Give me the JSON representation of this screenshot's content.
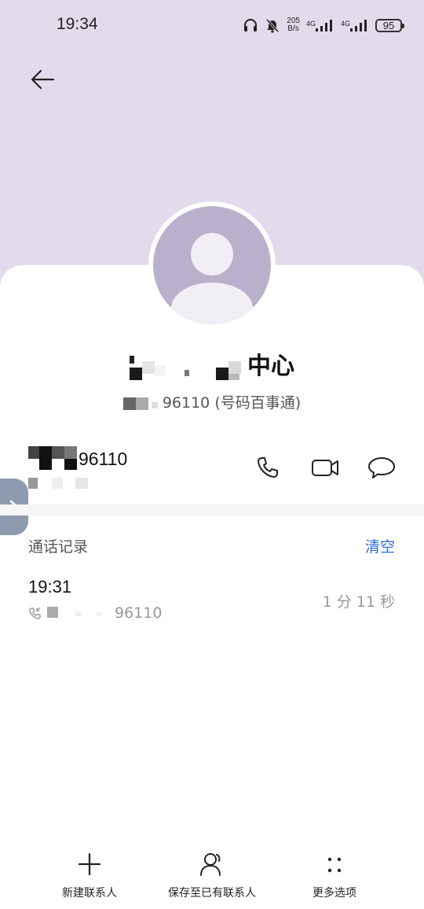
{
  "status_bar": {
    "time": "19:34",
    "net_speed_value": "205",
    "net_speed_unit": "B/s",
    "signal_1_label": "4G",
    "signal_2_label": "4G",
    "battery": "95",
    "icons": [
      "headphones-icon",
      "mute-icon",
      "signal-icon",
      "signal-icon"
    ]
  },
  "contact": {
    "name_suffix": "中心",
    "subtitle_number_suffix": "96110",
    "subtitle_source": "(号码百事通)"
  },
  "phone": {
    "number_suffix": "96110",
    "actions": [
      "phone-icon",
      "video-call-icon",
      "message-icon"
    ]
  },
  "call_log": {
    "title": "通话记录",
    "clear_label": "清空",
    "entries": [
      {
        "time": "19:31",
        "number_suffix": "96110",
        "duration": "1 分 11 秒"
      }
    ]
  },
  "bottom_actions": [
    {
      "label": "新建联系人",
      "icon": "plus-icon"
    },
    {
      "label": "保存至已有联系人",
      "icon": "add-person-icon"
    },
    {
      "label": "更多选项",
      "icon": "more-options-icon"
    }
  ],
  "colors": {
    "header_bg": "#e1dbeb",
    "avatar_bg": "#b9b0cb",
    "accent": "#2a6bd8",
    "side_tab": "#8e9aae"
  }
}
